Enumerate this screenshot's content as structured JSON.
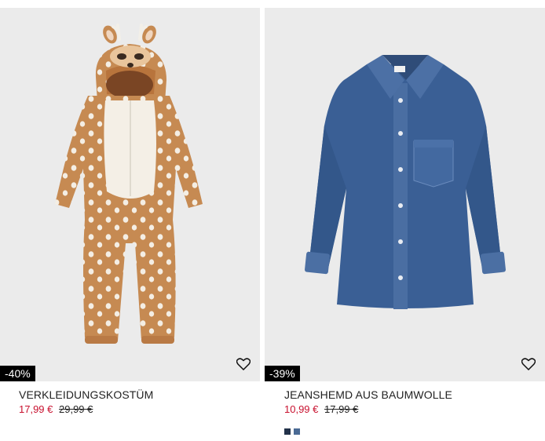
{
  "products": [
    {
      "discount_badge": "-40%",
      "title": "VERKLEIDUNGSKOSTÜM",
      "sale_price": "17,99 €",
      "original_price": "29,99 €",
      "image_alt": "fawn costume onesie",
      "favorite_icon": "heart-outline-icon"
    },
    {
      "discount_badge": "-39%",
      "title": "JEANSHEMD AUS BAUMWOLLE",
      "sale_price": "10,99 €",
      "original_price": "17,99 €",
      "image_alt": "denim shirt",
      "favorite_icon": "heart-outline-icon",
      "color_swatches": [
        "#22324a",
        "#4a6a94"
      ]
    }
  ],
  "colors": {
    "sale_red": "#c8102e",
    "image_bg": "#ebebeb",
    "badge_bg": "#000000"
  }
}
